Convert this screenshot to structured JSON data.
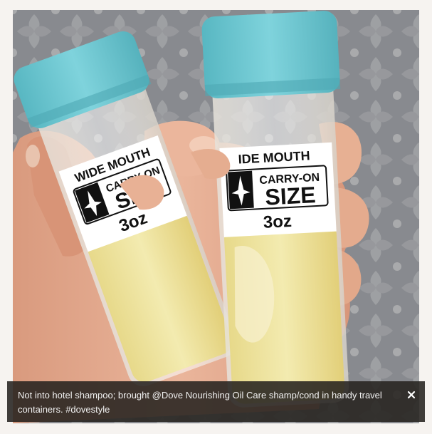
{
  "photo": {
    "subject": "Two travel bottles with blue caps held in a hand",
    "bottle_labels": {
      "line1": "WIDE MOUTH",
      "line1_right": "IDE MOUTH",
      "line2": "CARRY-ON",
      "line3": "SIZE",
      "line4": "3oz"
    }
  },
  "caption": {
    "text": "Not into hotel shampoo; brought @Dove Nourishing Oil Care shamp/cond in handy travel containers. #dovestyle"
  },
  "controls": {
    "close_icon": "close-icon"
  },
  "colors": {
    "cap": "#6cc8d2",
    "caption_bg": "#26221f",
    "caption_text": "#f2f2f2"
  }
}
